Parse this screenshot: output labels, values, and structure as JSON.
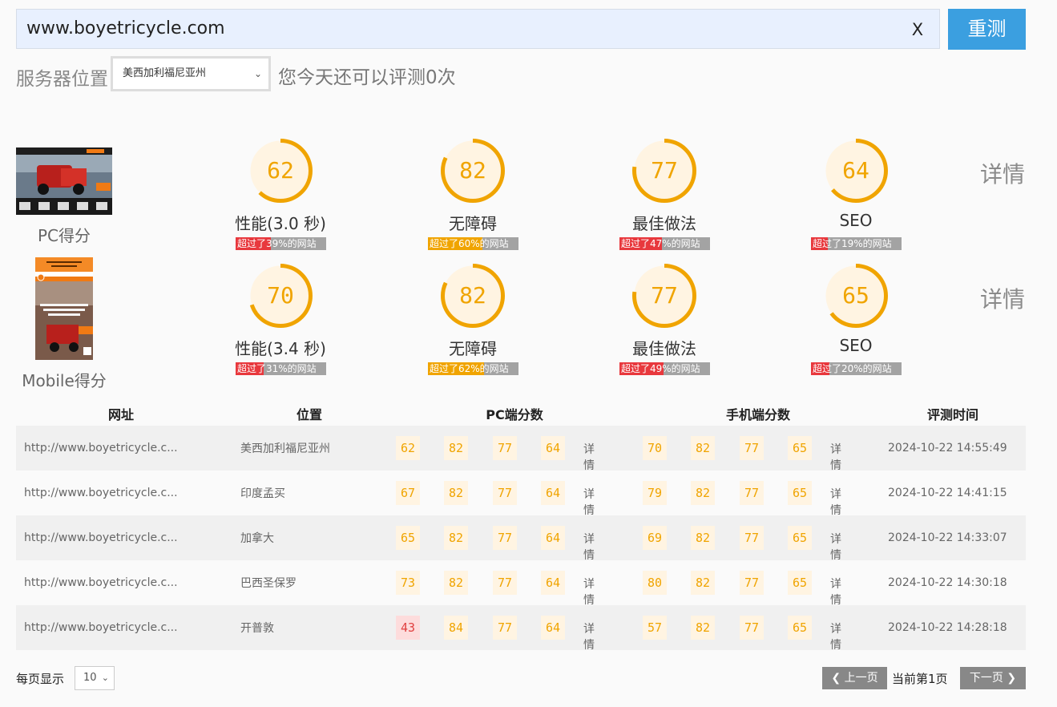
{
  "search": {
    "url_value": "www.boyetricycle.com",
    "clear_label": "X",
    "retest_label": "重测"
  },
  "server": {
    "label": "服务器位置",
    "selected": "美西加利福尼亚州",
    "quota_text": "您今天还可以评测0次"
  },
  "rows": [
    {
      "label": "PC得分",
      "detail_label": "详情",
      "metrics": [
        {
          "score": "62",
          "label": "性能(3.0 秒)",
          "bar_text": "超过了39%的网站",
          "percent": 39,
          "bar_color": "#e8383d"
        },
        {
          "score": "82",
          "label": "无障碍",
          "bar_text": "超过了60%的网站",
          "percent": 60,
          "bar_color": "#f0a400"
        },
        {
          "score": "77",
          "label": "最佳做法",
          "bar_text": "超过了47%的网站",
          "percent": 47,
          "bar_color": "#e8383d"
        },
        {
          "score": "64",
          "label": "SEO",
          "bar_text": "超过了19%的网站",
          "percent": 19,
          "bar_color": "#e8383d"
        }
      ]
    },
    {
      "label": "Mobile得分",
      "detail_label": "详情",
      "metrics": [
        {
          "score": "70",
          "label": "性能(3.4 秒)",
          "bar_text": "超过了31%的网站",
          "percent": 31,
          "bar_color": "#e8383d"
        },
        {
          "score": "82",
          "label": "无障碍",
          "bar_text": "超过了62%的网站",
          "percent": 62,
          "bar_color": "#f0a400"
        },
        {
          "score": "77",
          "label": "最佳做法",
          "bar_text": "超过了49%的网站",
          "percent": 49,
          "bar_color": "#e8383d"
        },
        {
          "score": "65",
          "label": "SEO",
          "bar_text": "超过了20%的网站",
          "percent": 20,
          "bar_color": "#e8383d"
        }
      ]
    }
  ],
  "table": {
    "headers": [
      "网址",
      "位置",
      "PC端分数",
      "手机端分数",
      "评测时间"
    ],
    "rows": [
      {
        "url": "http://www.boyetricycle.c...",
        "location": "美西加利福尼亚州",
        "pc": [
          "62",
          "82",
          "77",
          "64"
        ],
        "pc_detail": "详情",
        "mobile": [
          "70",
          "82",
          "77",
          "65"
        ],
        "mobile_detail": "详情",
        "time": "2024-10-22 14:55:49"
      },
      {
        "url": "http://www.boyetricycle.c...",
        "location": "印度孟买",
        "pc": [
          "67",
          "82",
          "77",
          "64"
        ],
        "pc_detail": "详情",
        "mobile": [
          "79",
          "82",
          "77",
          "65"
        ],
        "mobile_detail": "详情",
        "time": "2024-10-22 14:41:15"
      },
      {
        "url": "http://www.boyetricycle.c...",
        "location": "加拿大",
        "pc": [
          "65",
          "82",
          "77",
          "64"
        ],
        "pc_detail": "详情",
        "mobile": [
          "69",
          "82",
          "77",
          "65"
        ],
        "mobile_detail": "详情",
        "time": "2024-10-22 14:33:07"
      },
      {
        "url": "http://www.boyetricycle.c...",
        "location": "巴西圣保罗",
        "pc": [
          "73",
          "82",
          "77",
          "64"
        ],
        "pc_detail": "详情",
        "mobile": [
          "80",
          "82",
          "77",
          "65"
        ],
        "mobile_detail": "详情",
        "time": "2024-10-22 14:30:18"
      },
      {
        "url": "http://www.boyetricycle.c...",
        "location": "开普敦",
        "pc": [
          "43",
          "84",
          "77",
          "64"
        ],
        "pc_detail": "详情",
        "mobile": [
          "57",
          "82",
          "77",
          "65"
        ],
        "mobile_detail": "详情",
        "time": "2024-10-22 14:28:18"
      }
    ]
  },
  "pagination": {
    "per_page_label": "每页显示",
    "per_page_value": "10",
    "prev_label": "上一页",
    "current_label": "当前第1页",
    "next_label": "下一页"
  },
  "colors": {
    "gauge": "#f0a400",
    "gauge_bg": "#fff4e2",
    "bad": "#e04040",
    "accent": "#3b9fe0"
  }
}
